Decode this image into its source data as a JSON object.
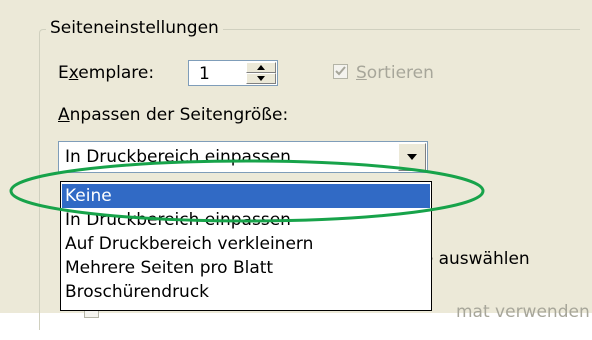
{
  "group": {
    "title": "Seiteneinstellungen"
  },
  "copies": {
    "label_pre": "E",
    "label_key": "x",
    "label_post": "emplare:",
    "value": "1",
    "collate_key": "S",
    "collate_rest": "ortieren",
    "collate_checked": true
  },
  "scaling": {
    "label_key": "A",
    "label_rest": "npassen der Seitengröße:",
    "selected": "In Druckbereich einpassen",
    "options": [
      {
        "label": "Keine",
        "highlighted": true
      },
      {
        "label": "In Druckbereich einpassen",
        "highlighted": false
      },
      {
        "label": "Auf Druckbereich verkleinern",
        "highlighted": false
      },
      {
        "label": "Mehrere Seiten pro Blatt",
        "highlighted": false
      },
      {
        "label": "Broschürendruck",
        "highlighted": false
      }
    ]
  },
  "obscured": {
    "line1": "ße auswählen",
    "line2": "mat verwenden"
  },
  "colors": {
    "highlight": "#316ac5",
    "annotation": "#17a34a",
    "dialog_bg": "#ece9d8"
  },
  "annotation": {
    "shape": "ellipse",
    "target": "Keine"
  }
}
